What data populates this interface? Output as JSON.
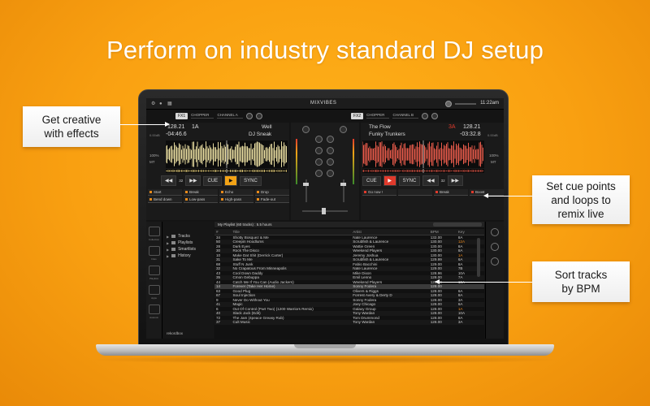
{
  "headline": "Perform on industry standard DJ setup",
  "callouts": {
    "effects": [
      "Get creative",
      "with effects"
    ],
    "cue": [
      "Set cue points",
      "and loops to",
      "remix live"
    ],
    "bpm": [
      "Sort tracks",
      "by BPM"
    ]
  },
  "app": {
    "brand": "MIXVIBES",
    "clock": "11:22am",
    "fx_left": {
      "button": "FX1",
      "effect": "CHOPPER",
      "channel": "CHANNEL A"
    },
    "fx_right": {
      "button": "FX2",
      "effect": "CHOPPER",
      "channel": "CHANNEL B"
    },
    "deck_left": {
      "bpm": "128.21",
      "key": "1A",
      "time": "-04:46.6",
      "gain": "0.00dB",
      "title": "Well",
      "artist": "DJ Sneak",
      "pitch": "100%",
      "mode": "MT",
      "loop": "32",
      "cue_label": "CUE",
      "sync_label": "SYNC",
      "cues": [
        "Start",
        "Break",
        "Echo",
        "Drop",
        "Bend down",
        "Low-pass",
        "High-pass",
        "Fade-out"
      ]
    },
    "deck_right": {
      "bpm": "128.21",
      "key": "3A",
      "time": "-03:32.8",
      "gain": "0.00dB",
      "title": "The Flow",
      "artist": "Funky Trunkers",
      "pitch": "100%",
      "mode": "MT",
      "loop": "32",
      "cue_label": "CUE",
      "sync_label": "SYNC",
      "cues": [
        "Go now !",
        "",
        "Break",
        "Boost"
      ]
    },
    "sidebar_labels": [
      "Collection",
      "Files",
      "Playlists",
      "Apps",
      "Automix"
    ],
    "tree": [
      "Tracks",
      "Playlists",
      "Smartlists",
      "History"
    ],
    "rekordbox": "rekordbox",
    "playlist_header": "My Playlist (60 tracks) : 5.5 hours",
    "columns": {
      "num": "#",
      "title": "Title",
      "artist": "Artist",
      "bpm": "BPM",
      "key": "Key"
    },
    "tracks": [
      {
        "n": "34",
        "title": "Shotty Bosquez & Me",
        "artist": "Nate Laurence",
        "bpm": "132.00",
        "key": "8A"
      },
      {
        "n": "50",
        "title": "Creepin Hoodlums",
        "artist": "Scrubfish & Laurence",
        "bpm": "130.00",
        "key": "12A"
      },
      {
        "n": "28",
        "title": "Dark Eyes",
        "artist": "Wattie Green",
        "bpm": "130.00",
        "key": "8A"
      },
      {
        "n": "30",
        "title": "Rock The Disco",
        "artist": "Weekend Players",
        "bpm": "130.00",
        "key": "8A"
      },
      {
        "n": "10",
        "title": "Make Dat Shit (Derrick Carter)",
        "artist": "Jeremy Joshua",
        "bpm": "130.00",
        "key": "1A"
      },
      {
        "n": "31",
        "title": "Sake To Me",
        "artist": "Scrubfish & Laurence",
        "bpm": "129.99",
        "key": "6A"
      },
      {
        "n": "68",
        "title": "Stuff N Junk",
        "artist": "Fabio Bacchini",
        "bpm": "129.00",
        "key": "8A"
      },
      {
        "n": "32",
        "title": "No Crapatous From Minneapolis",
        "artist": "Nate Laurence",
        "bpm": "129.00",
        "key": "7B"
      },
      {
        "n": "43",
        "title": "Cool Down Daddy",
        "artist": "Mike Dixon",
        "bpm": "128.96",
        "key": "10A"
      },
      {
        "n": "35",
        "title": "Cmon Gebuppa",
        "artist": "Emil Lenno",
        "bpm": "128.00",
        "key": "7A"
      },
      {
        "n": "44",
        "title": "Catch Me If You Can (Audio Jackers)",
        "artist": "Weekend Players",
        "bpm": "128.00",
        "key": "10A"
      },
      {
        "n": "14",
        "title": "Forever (Take Her Home)",
        "artist": "Sonny Fodera",
        "bpm": "128.00",
        "key": ""
      },
      {
        "n": "63",
        "title": "Good Plug",
        "artist": "Olivers & Riggs",
        "bpm": "128.00",
        "key": "6A"
      },
      {
        "n": "67",
        "title": "Soul Injection",
        "artist": "Forrest Avery & Derty D",
        "bpm": "128.00",
        "key": "8A"
      },
      {
        "n": "9",
        "title": "Never Do Without You",
        "artist": "Sonny Fodera",
        "bpm": "128.00",
        "key": "3A"
      },
      {
        "n": "41",
        "title": "Magic",
        "artist": "Joey Chicago",
        "bpm": "128.00",
        "key": "6A"
      },
      {
        "n": "6",
        "title": "Out Of Control (Part Two) (1200 Warriors Remix)",
        "artist": "Galaxy Group",
        "bpm": "128.00",
        "key": "1A"
      },
      {
        "n": "40",
        "title": "Slack Jack (Edit)",
        "artist": "Tony Wardan",
        "bpm": "128.00",
        "key": "10A"
      },
      {
        "n": "72",
        "title": "The Jam (4peace Greasy Rub)",
        "artist": "Tom Drummond",
        "bpm": "128.00",
        "key": "8A"
      },
      {
        "n": "37",
        "title": "Cult Music",
        "artist": "Tony Wardan",
        "bpm": "128.00",
        "key": "3A"
      }
    ],
    "orange_keys": [
      "12A",
      "1A"
    ],
    "colors": {
      "accent": "#f2a316",
      "deck_right_accent": "#e03a2c",
      "background": "#f9a011"
    }
  }
}
